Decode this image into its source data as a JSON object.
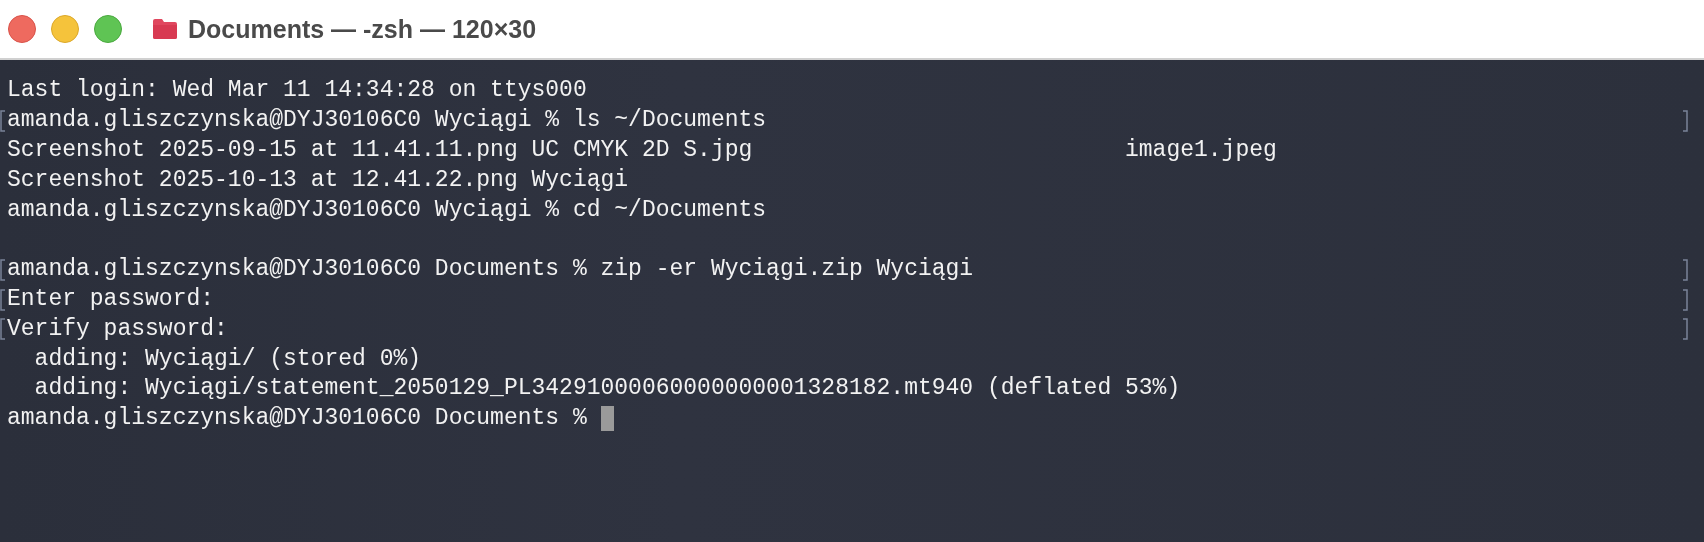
{
  "window": {
    "title": "Documents — -zsh — 120×30"
  },
  "terminal": {
    "lines": [
      {
        "kind": "text",
        "text": "Last login: Wed Mar 11 14:34:28 on ttys000",
        "marked": false
      },
      {
        "kind": "text",
        "text": "amanda.gliszczynska@DYJ30106C0 Wyciągi % ls ~/Documents",
        "marked": true
      },
      {
        "kind": "columns",
        "cells": [
          "Screenshot 2025-09-15 at 11.41.11.png",
          "UC CMYK 2D S.jpg",
          "image1.jpeg"
        ],
        "marked": false
      },
      {
        "kind": "columns",
        "cells": [
          "Screenshot 2025-10-13 at 12.41.22.png",
          "Wyciągi"
        ],
        "marked": false
      },
      {
        "kind": "text",
        "text": "amanda.gliszczynska@DYJ30106C0 Wyciągi % cd ~/Documents",
        "marked": false
      },
      {
        "kind": "blank",
        "marked": false
      },
      {
        "kind": "text",
        "text": "amanda.gliszczynska@DYJ30106C0 Documents % zip -er Wyciągi.zip Wyciągi",
        "marked": true
      },
      {
        "kind": "text",
        "text": "Enter password:",
        "marked": true
      },
      {
        "kind": "text",
        "text": "Verify password:",
        "marked": true
      },
      {
        "kind": "text",
        "text": "  adding: Wyciągi/ (stored 0%)",
        "marked": false
      },
      {
        "kind": "text",
        "text": "  adding: Wyciągi/statement_2050129_PL34291000060000000001328182.mt940 (deflated 53%)",
        "marked": false
      },
      {
        "kind": "prompt",
        "text": "amanda.gliszczynska@DYJ30106C0 Documents % ",
        "marked": false
      }
    ]
  }
}
